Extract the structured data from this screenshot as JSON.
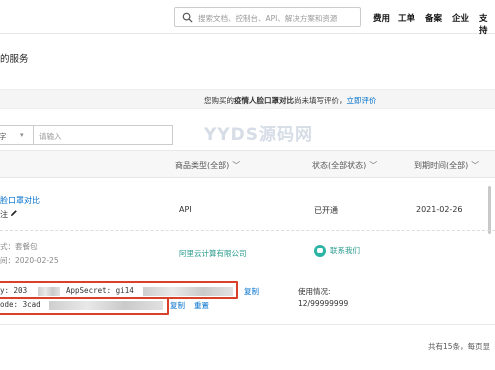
{
  "header": {
    "search_placeholder": "搜索文档、控制台、API、解决方案和资源",
    "nav": [
      "费用",
      "工单",
      "备案",
      "企业",
      "支持"
    ]
  },
  "page": {
    "title": "的服务"
  },
  "notice": {
    "prefix": "您购买的",
    "product": "疫情人脸口罩对比",
    "suffix": "尚未填写评价，",
    "link": "立即评价"
  },
  "filter": {
    "select_label": "字",
    "input_placeholder": "请输入"
  },
  "watermark": "YYDS源码网",
  "table": {
    "columns": {
      "type": "商品类型(全部)",
      "status": "状态(全部状态)",
      "expire": "到期时间(全部)"
    }
  },
  "row": {
    "name": "脸口罩对比",
    "remark": "注",
    "type": "API",
    "status": "已开通",
    "expire": "2021-02-26",
    "meta_plan": "式：套餐包",
    "meta_time": "间：2020-02-25",
    "vendor": "阿里云计算有限公司",
    "contact": "联系我们",
    "key_prefix": "y: 203",
    "secret_label": "AppSecret: gi14",
    "code_prefix": "ode: 3cad",
    "copy1": "复制",
    "copy2": "复制",
    "reset": "重置",
    "usage_label": "使用情况:",
    "usage_value": "12/99999999"
  },
  "footer": {
    "total": "共有15条，每页显"
  },
  "colors": {
    "link": "#0070cc",
    "accent_red": "#d9412a",
    "teal": "#2a9a8e"
  }
}
